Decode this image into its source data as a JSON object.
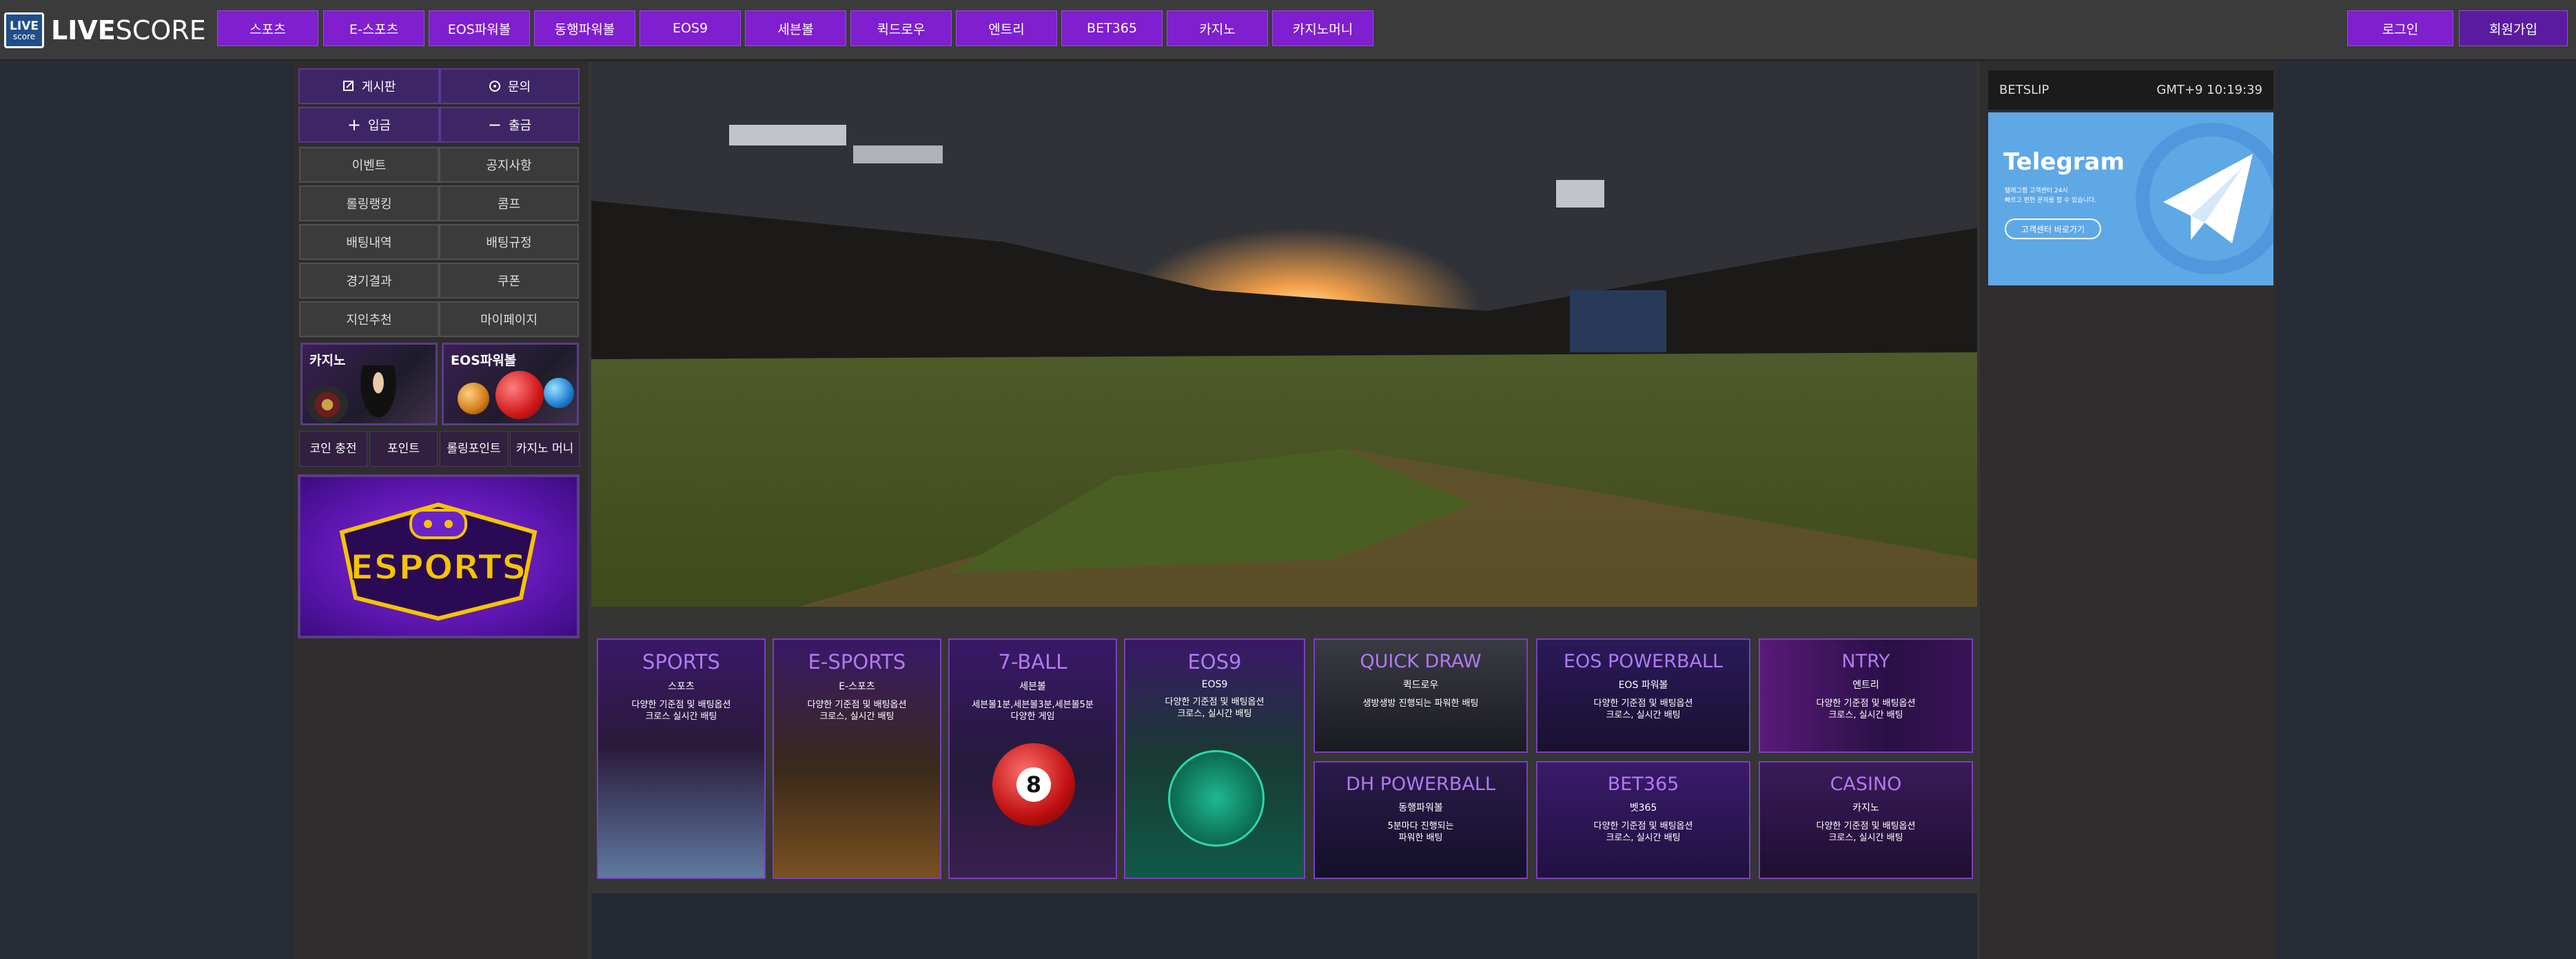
{
  "header": {
    "logo_top": "LIVE",
    "logo_bottom": "score",
    "logo_word_bold": "LIVE",
    "logo_word_rest": "SCORE",
    "nav": [
      "스포츠",
      "E-스포츠",
      "EOS파워볼",
      "동행파워볼",
      "EOS9",
      "세븐볼",
      "퀵드로우",
      "엔트리",
      "BET365",
      "카지노",
      "카지노머니"
    ],
    "login_label": "로그인",
    "signup_label": "회원가입"
  },
  "sidebar": {
    "board_label": "게시판",
    "inquiry_label": "문의",
    "deposit_label": "입금",
    "withdraw_label": "출금",
    "grid": [
      "이벤트",
      "공지사항",
      "롤링랭킹",
      "콤프",
      "배팅내역",
      "배팅규정",
      "경기결과",
      "쿠폰",
      "지인추천",
      "마이페이지"
    ],
    "promo_casino": "카지노",
    "promo_eos": "EOS파워볼",
    "small": [
      "코인 충전",
      "포인트",
      "롤링포인트",
      "카지노 머니"
    ],
    "esports_banner": "ESPORTS"
  },
  "cards": [
    {
      "title": "SPORTS",
      "kor": "스포츠",
      "desc": "다양한 기준점 및 배팅옵션\n크로스 실시간 배팅"
    },
    {
      "title": "E-SPORTS",
      "kor": "E-스포츠",
      "desc": "다양한 기준점 및 배팅옵션\n크로스, 실시간 배팅"
    },
    {
      "title": "7-BALL",
      "kor": "세븐볼",
      "desc": "세븐볼1분,세븐볼3분,세븐볼5분\n다양한 게임"
    },
    {
      "title": "EOS9",
      "kor": "EOS9",
      "desc": "다양한 기준점 및 배팅옵션\n크로스, 실시간 배팅"
    },
    {
      "title": "QUICK DRAW",
      "kor": "퀵드로우",
      "desc": "생방생방 진행되는 파워한 배팅"
    },
    {
      "title": "EOS POWERBALL",
      "kor": "EOS 파워볼",
      "desc": "다양한 기준점 및 배팅옵션\n크로스, 실시간 배팅"
    },
    {
      "title": "NTRY",
      "kor": "엔트리",
      "desc": "다양한 기준점 및 배팅옵션\n크로스, 실시간 배팅"
    },
    {
      "title": "DH POWERBALL",
      "kor": "동행파워볼",
      "desc": "5분마다 진행되는\n파워한 배팅"
    },
    {
      "title": "BET365",
      "kor": "벳365",
      "desc": "다양한 기준점 및 배팅옵션\n크로스, 실시간 배팅"
    },
    {
      "title": "CASINO",
      "kor": "카지노",
      "desc": "다양한 기준점 및 배팅옵션\n크로스, 실시간 배팅"
    }
  ],
  "betslip": {
    "label": "BETSLIP",
    "time": "GMT+9 10:19:39"
  },
  "telegram": {
    "title": "Telegram",
    "line1": "텔레그램 고객센터 24시",
    "line2": "빠르고 편한 문의를 할 수 있습니다.",
    "button": "고객센터 바로가기"
  },
  "colors": {
    "nav_purple": "#7f1fd0",
    "telegram_blue": "#5fa8e6",
    "card_title": "#b07af0"
  }
}
